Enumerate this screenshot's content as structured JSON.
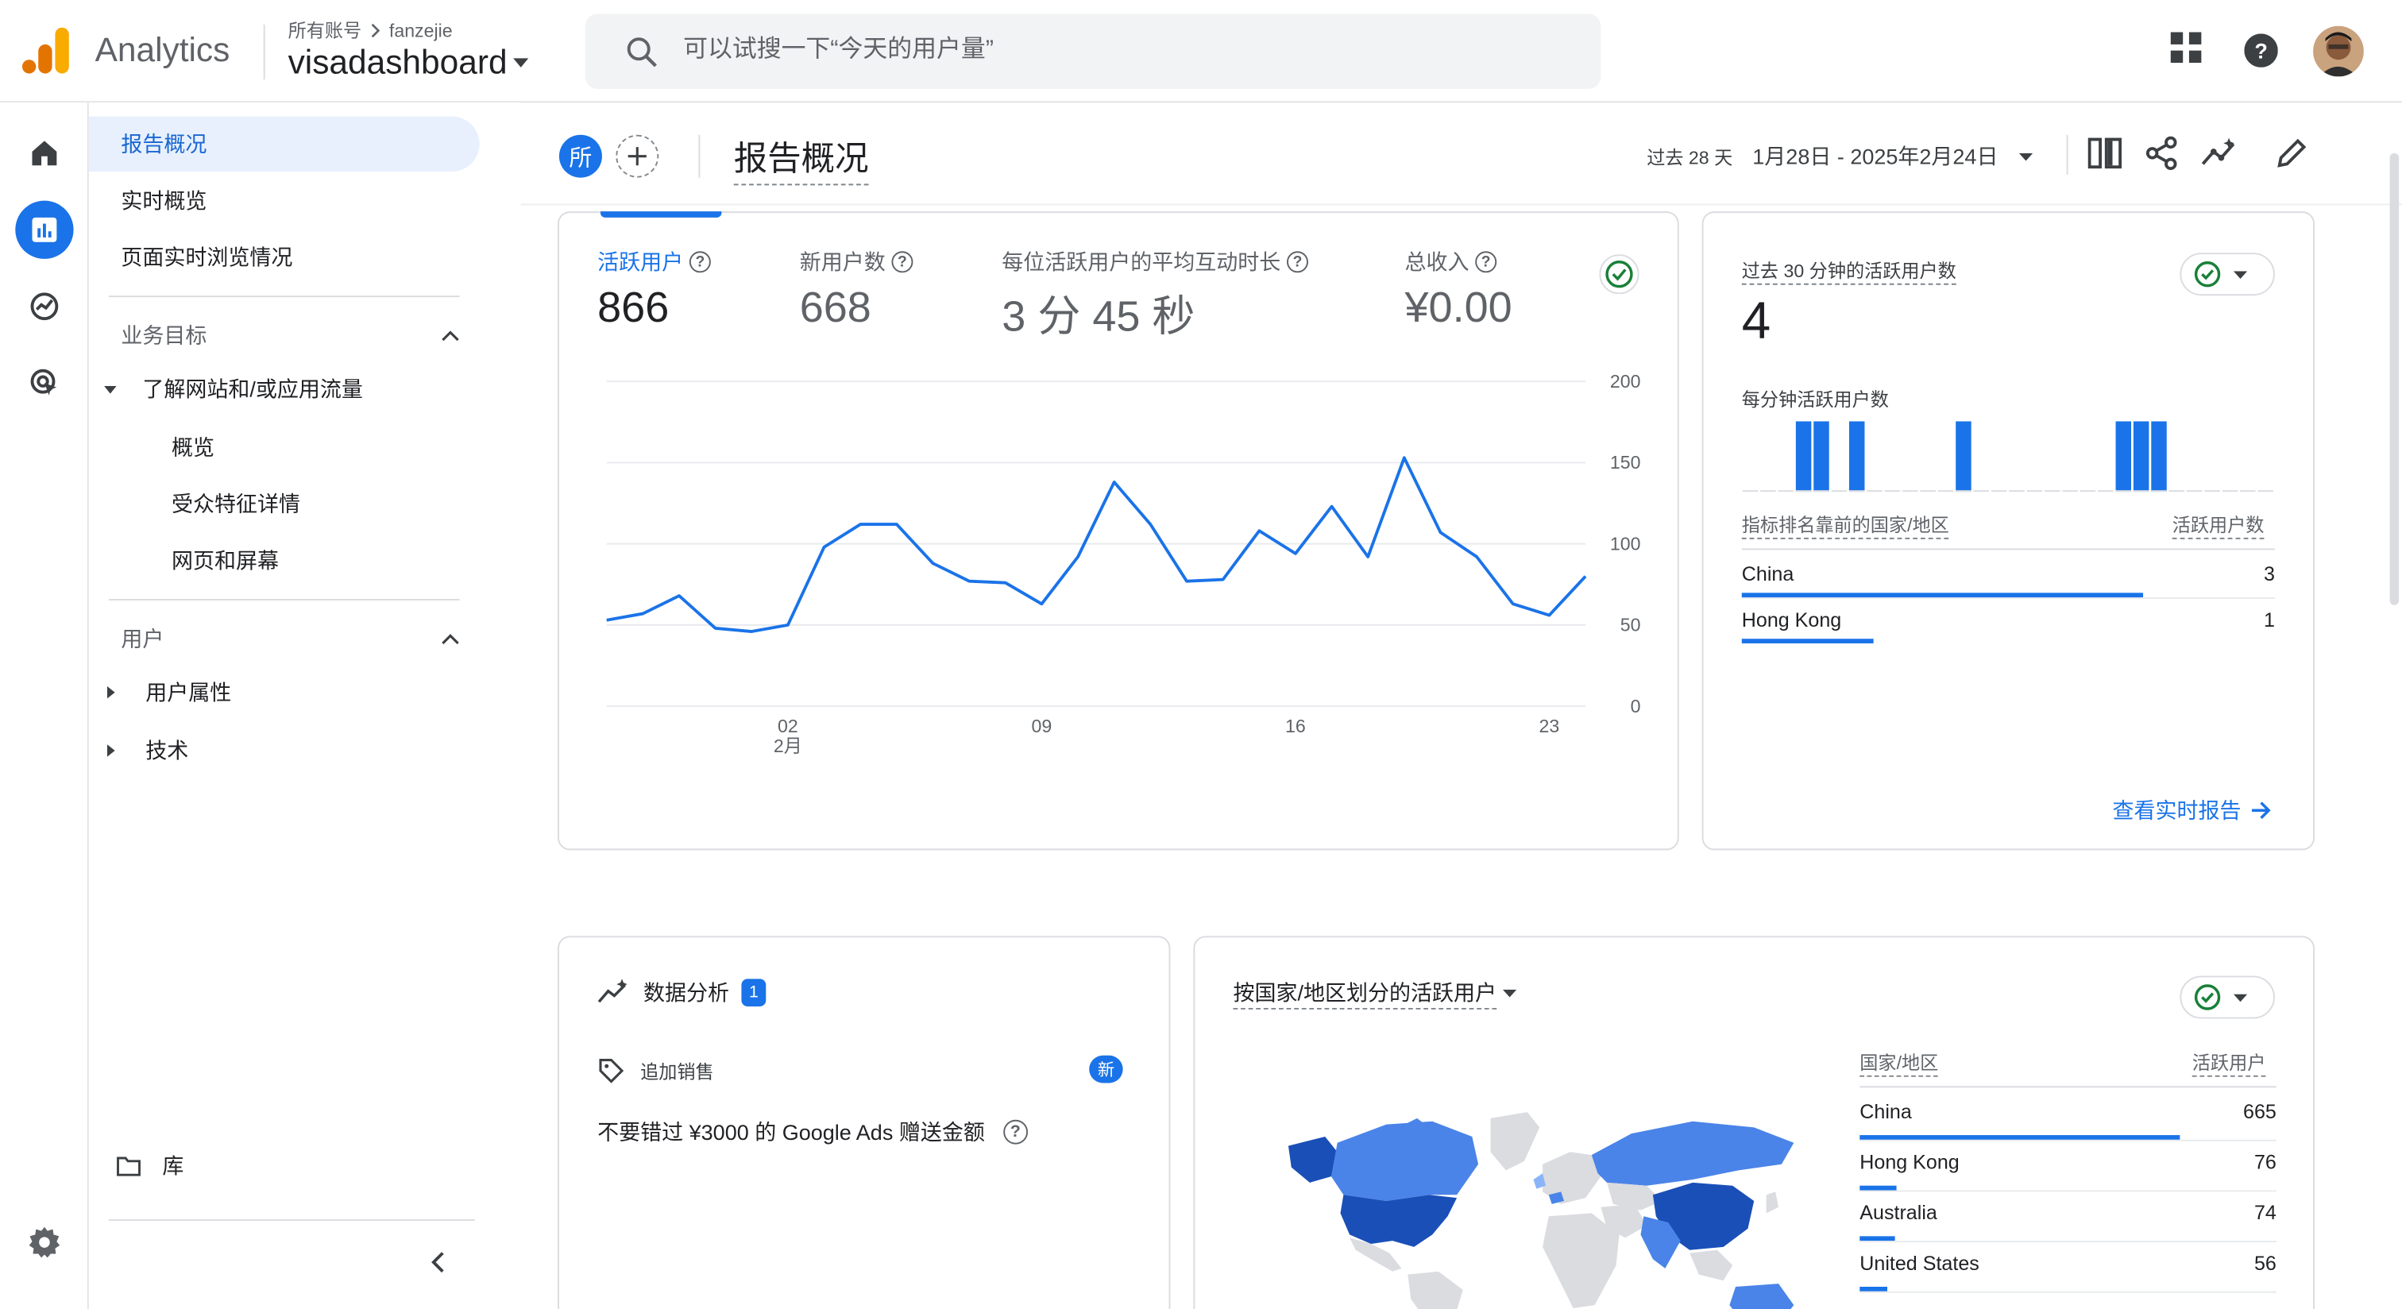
{
  "app": {
    "brand": "Analytics",
    "account_crumb": "所有账号",
    "account_name": "fanzejie",
    "property": "visadashboard"
  },
  "search": {
    "placeholder": "可以试搜一下“今天的用户量”"
  },
  "colors": {
    "accent": "#1a73e8",
    "map_dark": "#1a4fb8",
    "map_mid": "#4a84e8",
    "map_light": "#8ab4f8",
    "map_none": "#dadce0"
  },
  "sidebar": {
    "items": [
      {
        "label": "报告概况",
        "active": true
      },
      {
        "label": "实时概览"
      },
      {
        "label": "页面实时浏览情况"
      }
    ],
    "section_business": "业务目标",
    "business_group": "了解网站和/或应用流量",
    "business_sub": [
      "概览",
      "受众特征详情",
      "网页和屏幕"
    ],
    "section_users": "用户",
    "users_items": [
      "用户属性",
      "技术"
    ],
    "library": "库"
  },
  "header": {
    "chip": "所",
    "title": "报告概况",
    "date_label": "过去 28 天",
    "date_range": "1月28日 - 2025年2月24日"
  },
  "metrics": [
    {
      "label": "活跃用户",
      "value": "866"
    },
    {
      "label": "新用户数",
      "value": "668"
    },
    {
      "label": "每位活跃用户的平均互动时长",
      "value": "3 分 45 秒"
    },
    {
      "label": "总收入",
      "value": "¥0.00"
    }
  ],
  "chart_data": {
    "type": "line",
    "title": "",
    "xlabel": "",
    "ylabel": "",
    "x_ticks": [
      "02",
      "09",
      "16",
      "23"
    ],
    "x_tick_sub": "2月",
    "y_ticks": [
      0,
      50,
      100,
      150,
      200
    ],
    "ylim": [
      0,
      200
    ],
    "grid": true,
    "x": [
      "01-28",
      "01-29",
      "01-30",
      "01-31",
      "02-01",
      "02-02",
      "02-03",
      "02-04",
      "02-05",
      "02-06",
      "02-07",
      "02-08",
      "02-09",
      "02-10",
      "02-11",
      "02-12",
      "02-13",
      "02-14",
      "02-15",
      "02-16",
      "02-17",
      "02-18",
      "02-19",
      "02-20",
      "02-21",
      "02-22",
      "02-23",
      "02-24"
    ],
    "values": [
      53,
      57,
      68,
      48,
      46,
      50,
      98,
      112,
      112,
      88,
      77,
      76,
      63,
      92,
      138,
      112,
      77,
      78,
      108,
      94,
      123,
      92,
      153,
      107,
      92,
      63,
      56,
      80
    ]
  },
  "realtime": {
    "title": "过去 30 分钟的活跃用户数",
    "value": "4",
    "per_minute_label": "每分钟活跃用户数",
    "per_minute": [
      0,
      0,
      0,
      1,
      1,
      0,
      1,
      0,
      0,
      0,
      0,
      0,
      1,
      0,
      0,
      0,
      0,
      0,
      0,
      0,
      0,
      1,
      1,
      1,
      0,
      0,
      0,
      0,
      0,
      0
    ],
    "table_head_left": "指标排名靠前的国家/地区",
    "table_head_right": "活跃用户数",
    "rows": [
      {
        "name": "China",
        "value": "3",
        "share": 1.0
      },
      {
        "name": "Hong Kong",
        "value": "1",
        "share": 0.33
      }
    ],
    "link": "查看实时报告"
  },
  "insights": {
    "title": "数据分析",
    "count": "1",
    "tag": "追加销售",
    "new_badge": "新",
    "text": "不要错过 ¥3000 的 Google Ads 赠送金额"
  },
  "geo": {
    "title": "按国家/地区划分的活跃用户",
    "head_left": "国家/地区",
    "head_right": "活跃用户",
    "rows": [
      {
        "name": "China",
        "value": "665",
        "share": 1.0
      },
      {
        "name": "Hong Kong",
        "value": "76",
        "share": 0.114
      },
      {
        "name": "Australia",
        "value": "74",
        "share": 0.111
      },
      {
        "name": "United States",
        "value": "56",
        "share": 0.084
      }
    ]
  }
}
